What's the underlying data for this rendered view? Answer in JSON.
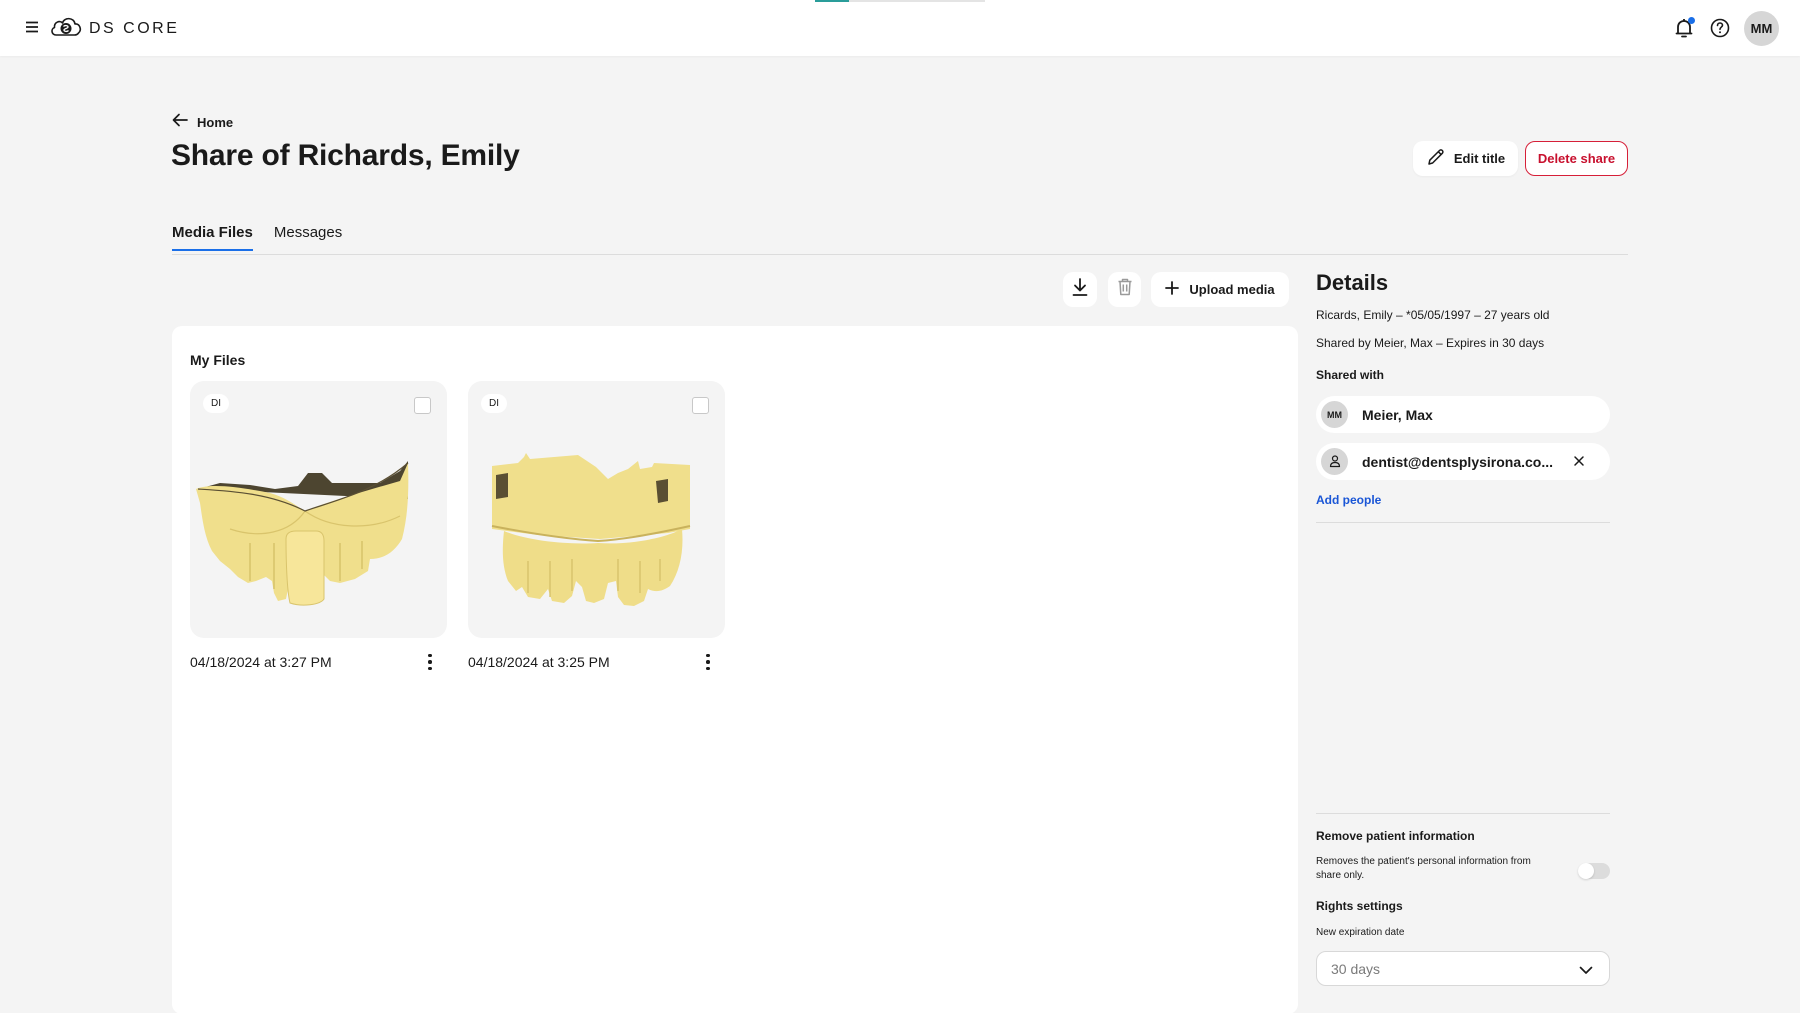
{
  "app": {
    "brand": "DS CORE",
    "loading_progress_percent": 20,
    "user_initials": "MM",
    "icons": {
      "menu": "menu-icon",
      "logo": "cloud-logo-icon",
      "notifications": "bell-icon",
      "notification_badge": true,
      "help": "help-icon"
    }
  },
  "header": {
    "back_label": "Home",
    "title": "Share of Richards, Emily",
    "edit_title_label": "Edit title",
    "delete_share_label": "Delete share"
  },
  "tabs": [
    {
      "label": "Media Files",
      "active": true
    },
    {
      "label": "Messages",
      "active": false
    }
  ],
  "toolbar": {
    "download_icon": "download-icon",
    "delete_icon": "trash-icon",
    "upload_label": "Upload media"
  },
  "files": {
    "section_title": "My Files",
    "items": [
      {
        "badge": "DI",
        "date": "04/18/2024 at 3:27 PM",
        "selected": false,
        "thumbnail": "dental-scan-upper-jaw-front"
      },
      {
        "badge": "DI",
        "date": "04/18/2024 at 3:25 PM",
        "selected": false,
        "thumbnail": "dental-scan-upper-jaw-base"
      }
    ]
  },
  "details": {
    "title": "Details",
    "patient_line": "Ricards, Emily – *05/05/1997 – 27 years old",
    "shared_by_line": "Shared by Meier, Max – Expires in 30 days",
    "shared_with_label": "Shared with",
    "shared_with": [
      {
        "initials": "MM",
        "name": "Meier, Max",
        "removable": false
      },
      {
        "initials": "",
        "name": "dentist@dentsplysirona.co...",
        "removable": true
      }
    ],
    "add_people_label": "Add people",
    "remove_patient_info": {
      "title": "Remove patient information",
      "description": "Removes the patient's personal information from share only.",
      "enabled": false
    },
    "rights_settings": {
      "title": "Rights settings",
      "expiration_label": "New expiration date",
      "expiration_value": "30 days"
    }
  },
  "colors": {
    "accent_blue": "#1a6fe8",
    "danger_red": "#c8102e",
    "link_blue": "#1a56d6",
    "progress_teal": "#2a9d9a",
    "model_yellow": "#f2e08e"
  }
}
